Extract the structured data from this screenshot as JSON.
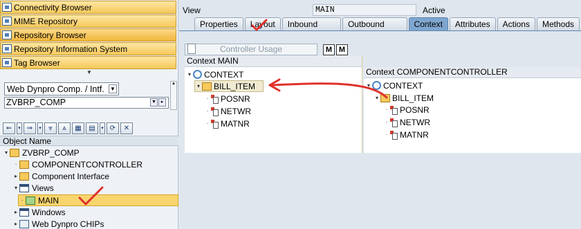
{
  "left_nav": {
    "items": [
      {
        "label": "Connectivity Browser"
      },
      {
        "label": "MIME Repository"
      },
      {
        "label": "Repository Browser"
      },
      {
        "label": "Repository Information System"
      },
      {
        "label": "Tag Browser"
      }
    ]
  },
  "object_selector": {
    "type_value": "Web Dynpro Comp. / Intf.",
    "name_value": "ZVBRP_COMP"
  },
  "object_tree": {
    "header": "Object Name",
    "items": [
      {
        "label": "ZVBRP_COMP"
      },
      {
        "label": "COMPONENTCONTROLLER"
      },
      {
        "label": "Component Interface"
      },
      {
        "label": "Views"
      },
      {
        "label": "MAIN"
      },
      {
        "label": "Windows"
      },
      {
        "label": "Web Dynpro CHIPs"
      }
    ]
  },
  "view_header": {
    "label": "View",
    "value": "MAIN",
    "status": "Active"
  },
  "tabs": [
    {
      "label": "Properties"
    },
    {
      "label": "Layout"
    },
    {
      "label": "Inbound Plugs"
    },
    {
      "label": "Outbound Plugs"
    },
    {
      "label": "Context",
      "active": true
    },
    {
      "label": "Attributes"
    },
    {
      "label": "Actions"
    },
    {
      "label": "Methods"
    }
  ],
  "toolbar": {
    "controller_usage_label": "Controller Usage"
  },
  "context_main": {
    "title": "Context MAIN",
    "root": "CONTEXT",
    "node": "BILL_ITEM",
    "attributes": [
      "POSNR",
      "NETWR",
      "MATNR"
    ]
  },
  "context_component": {
    "title": "Context COMPONENTCONTROLLER",
    "root": "CONTEXT",
    "node": "BILL_ITEM",
    "attributes": [
      "POSNR",
      "NETWR",
      "MATNR"
    ]
  },
  "colors": {
    "accent": "#7ea6cf",
    "nav_button": "#f6c95b",
    "annotation": "#e0302a"
  }
}
